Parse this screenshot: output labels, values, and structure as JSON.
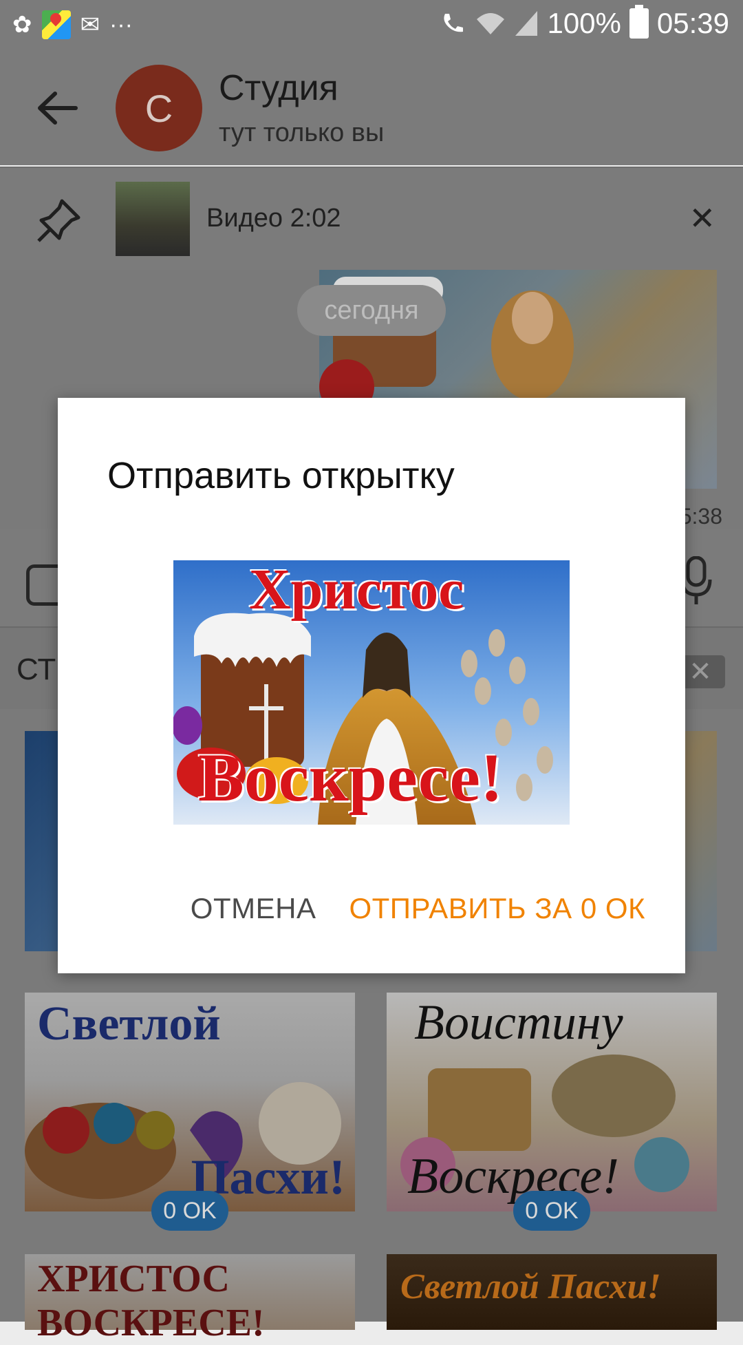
{
  "status_bar": {
    "battery": "100%",
    "time": "05:39",
    "left_icons": [
      "ok-icon",
      "maps-icon",
      "ok-mail-icon",
      "more-dots-icon"
    ],
    "right_icons": [
      "wifi-call-icon",
      "wifi-icon",
      "signal-icon",
      "battery-icon"
    ],
    "more_dots": "···"
  },
  "header": {
    "avatar_letter": "С",
    "title": "Студия",
    "subtitle": "тут только вы"
  },
  "pinned": {
    "text": "Видео 2:02",
    "close": "✕"
  },
  "chat": {
    "date_chip": "сегодня",
    "time": "5:38"
  },
  "sticker_bar": {
    "label": "СТ",
    "clear": "✕"
  },
  "grid": {
    "cards": [
      {
        "text_top": "Светлой",
        "text_bottom": "Пасхи!",
        "price": "0 OK"
      },
      {
        "text_top": "Воистину",
        "text_bottom": "Воскресе!",
        "price": "0 OK"
      },
      {
        "text_top": "ХРИСТОС ВОСКРЕСЕ!"
      },
      {
        "text_top": "Светлой Пасхи!"
      }
    ]
  },
  "dialog": {
    "title": "Отправить открытку",
    "card_line1": "Христос",
    "card_line2": "Воскресе!",
    "cancel": "ОТМЕНА",
    "send": "ОТПРАВИТЬ ЗА 0 ОК"
  },
  "colors": {
    "accent": "#f08200",
    "avatar": "#7a2b1c",
    "badge": "#1f5c8f"
  }
}
